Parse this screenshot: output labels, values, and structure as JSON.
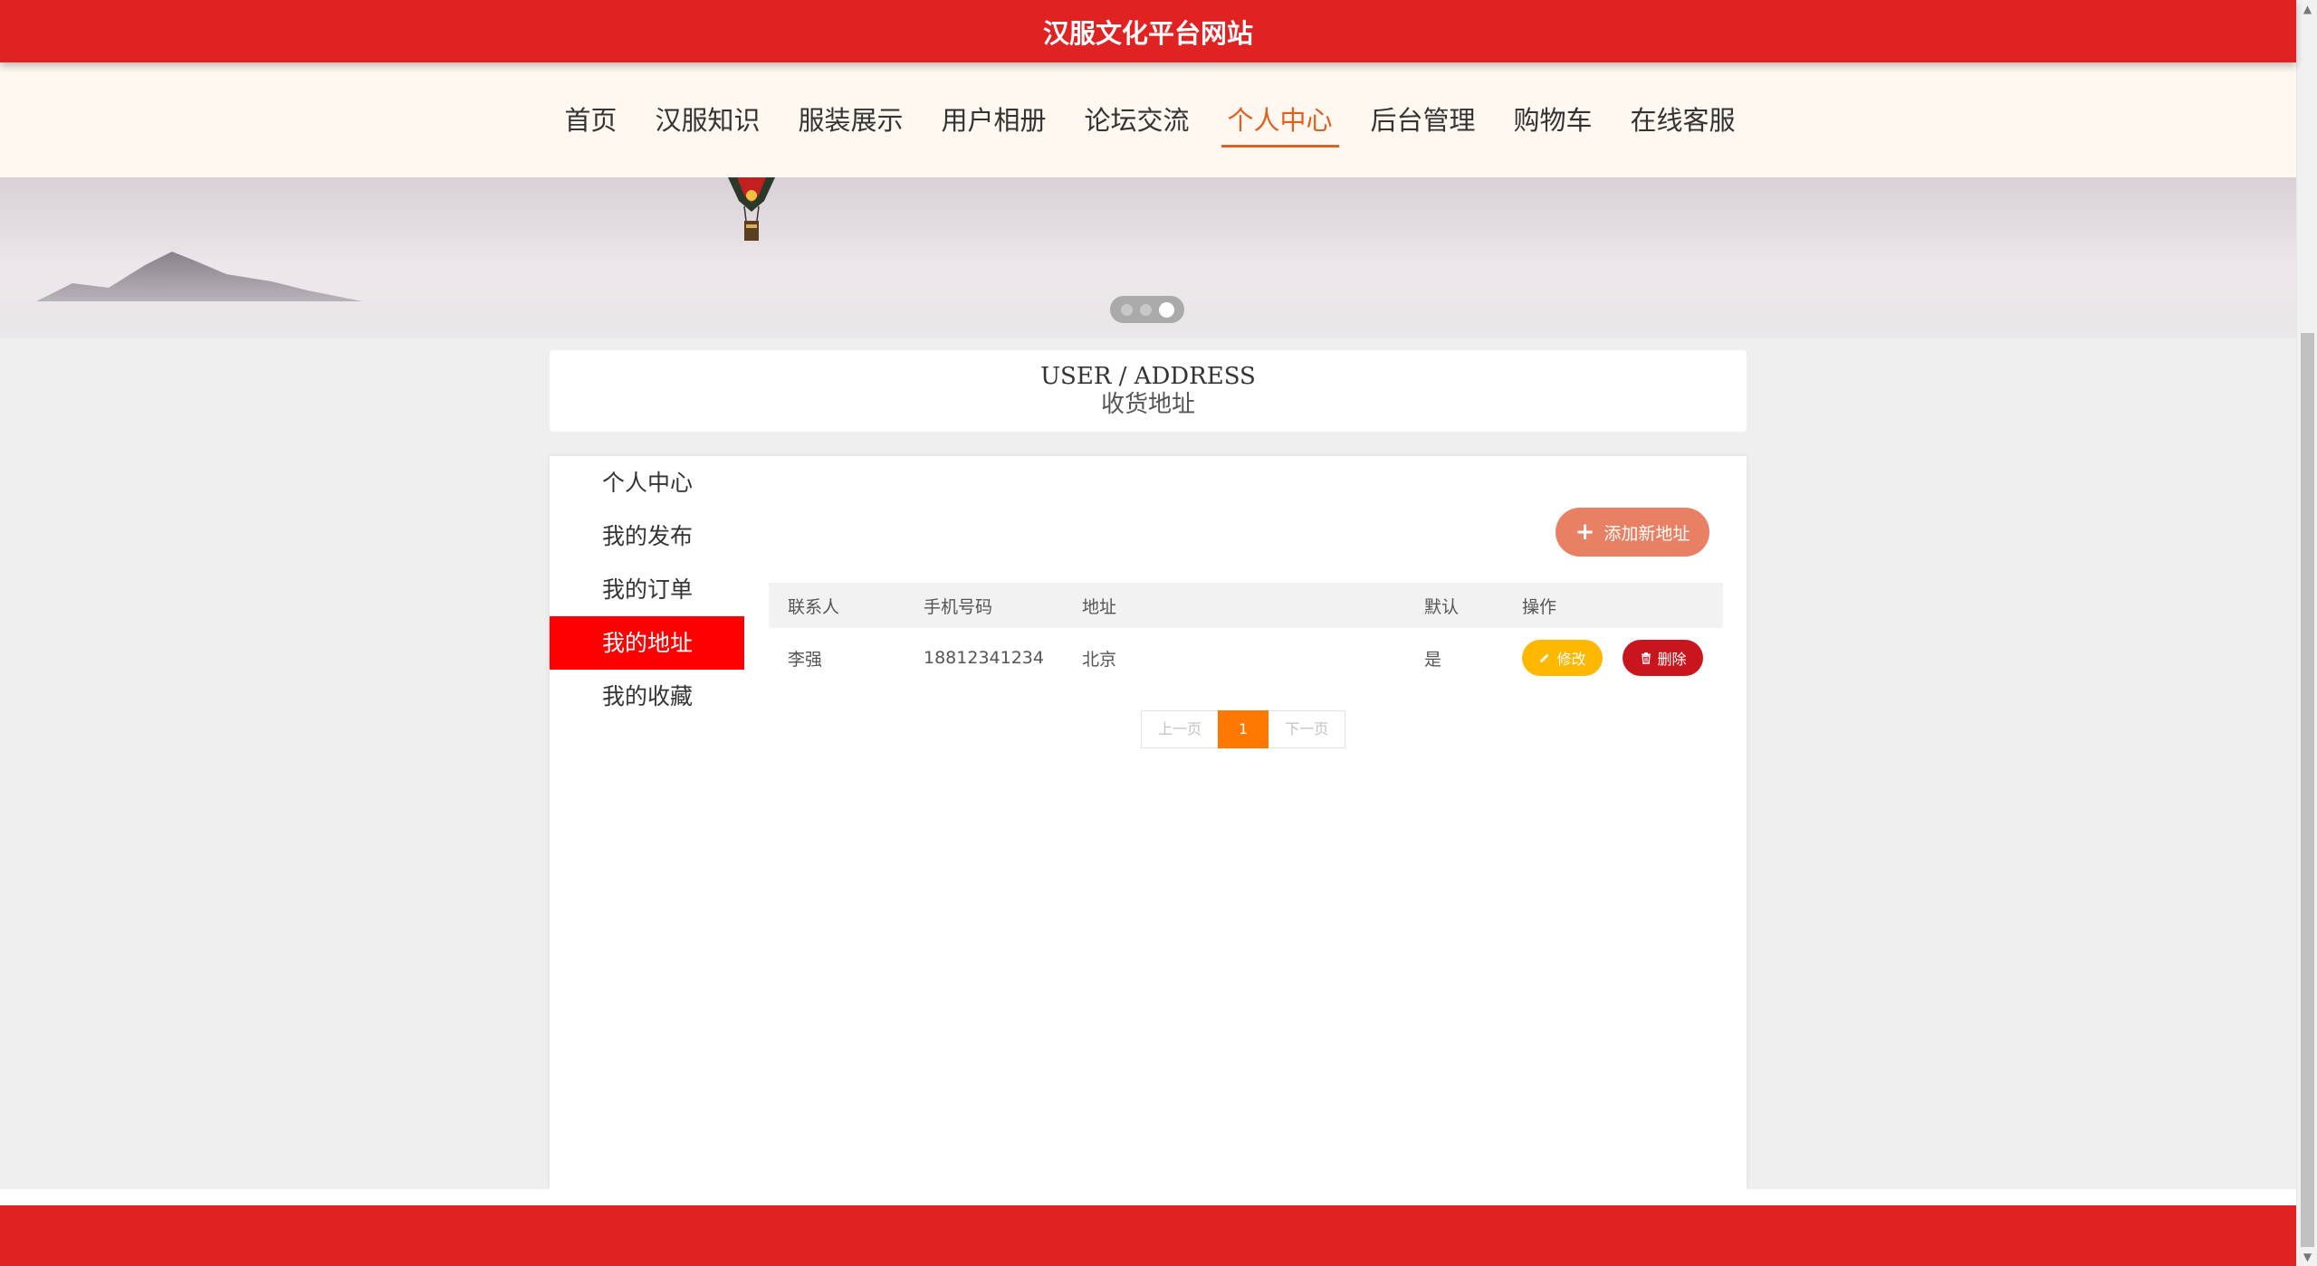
{
  "site": {
    "title": "汉服文化平台网站"
  },
  "nav": {
    "items": [
      "首页",
      "汉服知识",
      "服装展示",
      "用户相册",
      "论坛交流",
      "个人中心",
      "后台管理",
      "购物车",
      "在线客服"
    ],
    "active": "个人中心"
  },
  "banner": {
    "slide_count": 3,
    "active_slide": 3
  },
  "section": {
    "title_en": "USER / ADDRESS",
    "title_cn": "收货地址"
  },
  "side_menu": {
    "items": [
      "个人中心",
      "我的发布",
      "我的订单",
      "我的地址",
      "我的收藏"
    ],
    "active": "我的地址"
  },
  "add_button": {
    "label": "添加新地址"
  },
  "table": {
    "headers": [
      "联系人",
      "手机号码",
      "地址",
      "默认",
      "操作"
    ],
    "rows": [
      {
        "contact": "李强",
        "phone": "18812341234",
        "address": "北京",
        "default": "是"
      }
    ],
    "edit_label": "修改",
    "delete_label": "删除"
  },
  "pagination": {
    "prev_label": "上一页",
    "current": "1",
    "next_label": "下一页"
  },
  "colors": {
    "brand_red": "#e02223",
    "nav_active": "#e06020",
    "side_active": "#ff0000",
    "add_button": "#e88064",
    "edit_button": "#ffb800",
    "delete_button": "#c9151e",
    "page_current": "#ff7800"
  }
}
